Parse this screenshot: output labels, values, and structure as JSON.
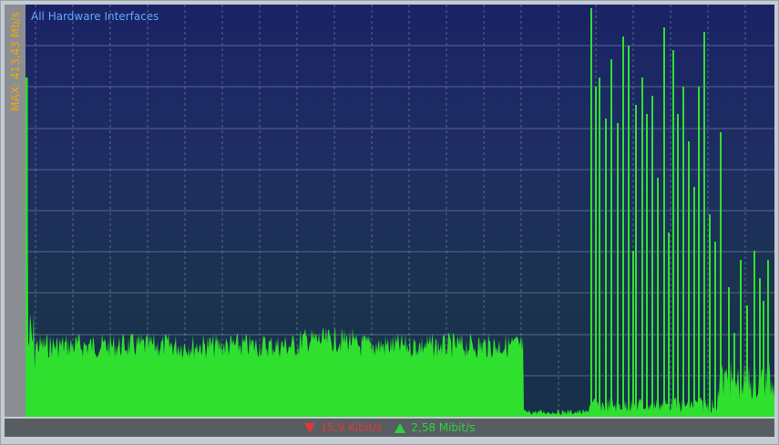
{
  "graph": {
    "title": "All Hardware Interfaces",
    "max_label": "MAX: 413,43 Mb/s",
    "colors": {
      "traffic": "#2fe02f",
      "grid": "#8a96b6",
      "background_top": "#1a2364",
      "background_bottom": "#173049"
    }
  },
  "status": {
    "download_icon": "down-arrow-icon",
    "download_rate": "15,9 Kibit/s",
    "upload_icon": "up-arrow-icon",
    "upload_rate": "2,58 Mibit/s"
  }
}
